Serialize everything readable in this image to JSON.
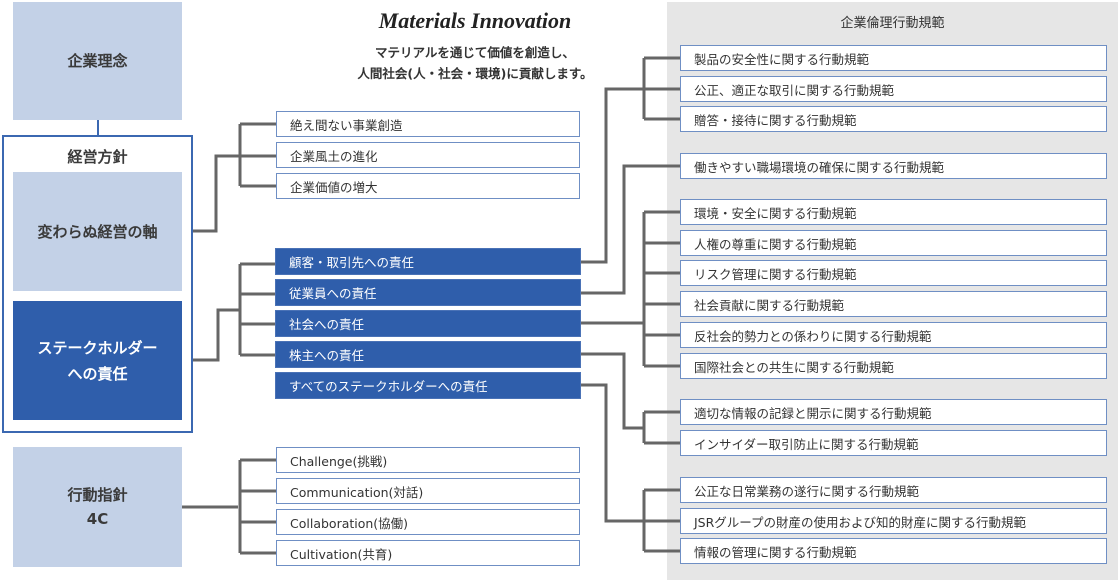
{
  "header": {
    "slogan": "Materials Innovation",
    "mission_line1": "マテリアルを通じて価値を創造し、",
    "mission_line2": "人間社会(人・社会・環境)に貢献します。"
  },
  "left": {
    "corporate_philosophy": "企業理念",
    "management_policy": {
      "title": "経営方針",
      "core_axis": "変わらぬ経営の軸",
      "stakeholder_line1": "ステークホルダー",
      "stakeholder_line2": "への責任"
    },
    "action_guideline_line1": "行動指針",
    "action_guideline_line2": "4C"
  },
  "core_axis_items": [
    "絶え間ない事業創造",
    "企業風土の進化",
    "企業価値の増大"
  ],
  "responsibilities": [
    "顧客・取引先への責任",
    "従業員への責任",
    "社会への責任",
    "株主への責任",
    "すべてのステークホルダーへの責任"
  ],
  "four_c": [
    "Challenge(挑戦)",
    "Communication(対話)",
    "Collaboration(協働)",
    "Cultivation(共育)"
  ],
  "code_of_conduct": {
    "title": "企業倫理行動規範",
    "groups": [
      [
        "製品の安全性に関する行動規範",
        "公正、適正な取引に関する行動規範",
        "贈答・接待に関する行動規範"
      ],
      [
        "働きやすい職場環境の確保に関する行動規範"
      ],
      [
        "環境・安全に関する行動規範",
        "人権の尊重に関する行動規範",
        "リスク管理に関する行動規範",
        "社会貢献に関する行動規範",
        "反社会的勢力との係わりに関する行動規範",
        "国際社会との共生に関する行動規範"
      ],
      [
        "適切な情報の記録と開示に関する行動規範",
        "インサイダー取引防止に関する行動規範"
      ],
      [
        "公正な日常業務の遂行に関する行動規範",
        "JSRグループの財産の使用および知的財産に関する行動規範",
        "情報の管理に関する行動規範"
      ]
    ]
  },
  "colors": {
    "light_blue": "#c3d1e7",
    "dark_blue": "#2f5eab",
    "connector_gray": "#666666",
    "panel_gray": "#e6e6e6"
  }
}
